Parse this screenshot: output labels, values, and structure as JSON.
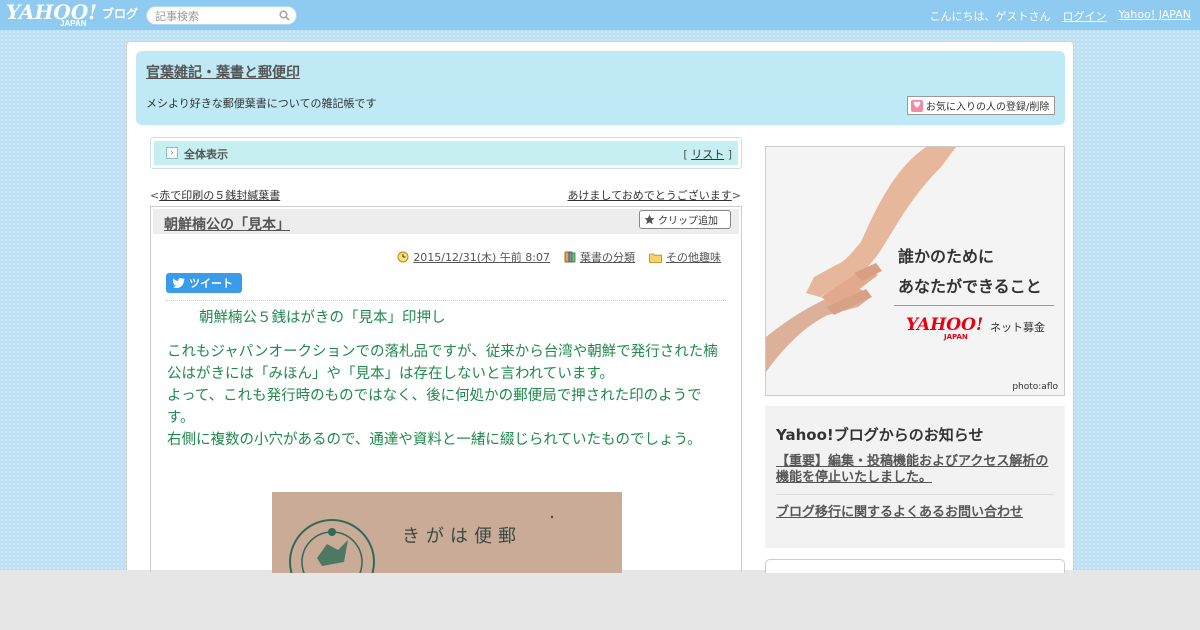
{
  "topbar": {
    "logo": "YAHOO!",
    "logo_japan": "JAPAN",
    "logo_blog": "ブログ",
    "search_placeholder": "記事検索",
    "greeting": "こんにちは、ゲストさん",
    "login": "ログイン",
    "yahoo_japan": "Yahoo! JAPAN"
  },
  "header": {
    "blog_title": "官葉雑記・葉書と郵便印",
    "description": "メシより好きな郵便葉書についての雑記帳です",
    "fav_button": "お気に入りの人の登録/削除"
  },
  "nav": {
    "all_view": "全体表示",
    "list_prefix": "[",
    "list": "リスト",
    "list_suffix": "]",
    "prev_prefix": "<",
    "prev": "赤で印刷の５銭封緘葉書",
    "next": "あけましておめでとうございます",
    "next_suffix": ">"
  },
  "article": {
    "title": "朝鮮楠公の「見本」",
    "clip": "クリップ追加",
    "date": "2015/12/31(木) 午前 8:07",
    "category1": "葉書の分類",
    "category2": "その他趣味",
    "tweet": "ツイート",
    "lead": "朝鮮楠公５銭はがきの「見本」印押し",
    "paragraph1": "これもジャパンオークションでの落札品ですが、従来から台湾や朝鮮で発行された楠公はがきには「みほん」や「見本」は存在しないと言われています。",
    "paragraph2": "よって、これも発行時のものではなく、後に何処かの郵便局で押された印のようです。",
    "paragraph3": "右側に複数の小穴があるので、通達や資料と一緒に綴じられていたものでしょう。",
    "postcard_text": "きがは便郵"
  },
  "ad": {
    "line1": "誰かのために",
    "line2": "あなたができること",
    "brand": "YAHOO!",
    "brand_japan": "JAPAN",
    "service": "ネット募金",
    "credit": "photo:aflo"
  },
  "notice": {
    "title": "Yahoo!ブログからのお知らせ",
    "link1": "【重要】編集・投稿機能およびアクセス解析の機能を停止いたしました。",
    "link2": "ブログ移行に関するよくあるお問い合わせ"
  },
  "colors": {
    "topbar": "#8fcaf0",
    "header_bg": "#bfeaf5",
    "article_text": "#1f8a4c",
    "tweet": "#3a9be8"
  }
}
